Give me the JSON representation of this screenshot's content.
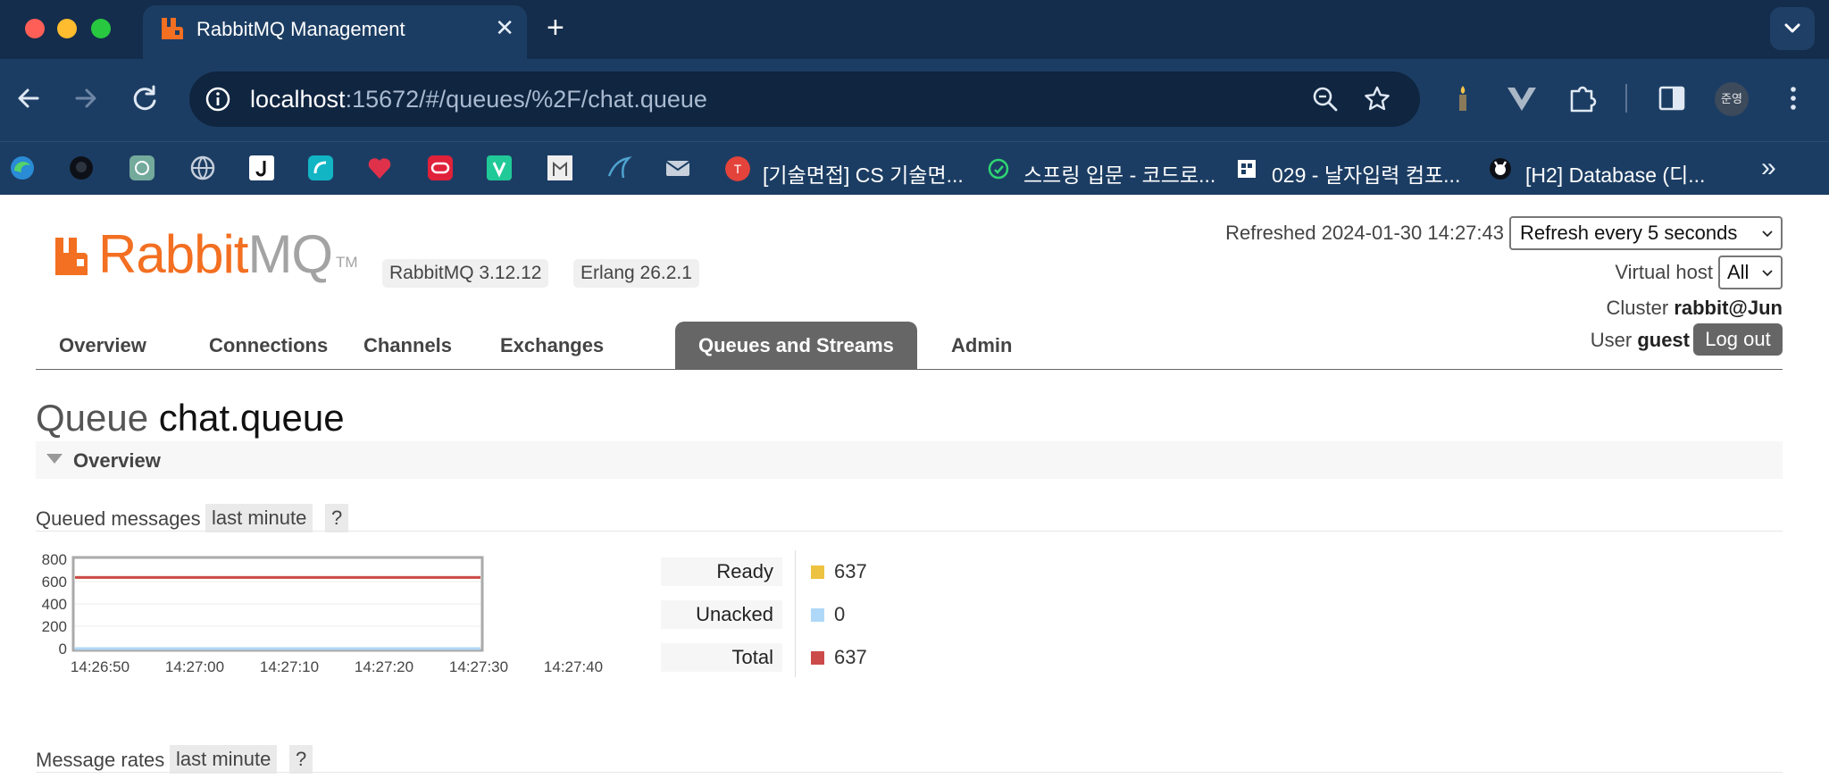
{
  "browser": {
    "tab_title": "RabbitMQ Management",
    "url_host": "localhost",
    "url_rest": ":15672/#/queues/%2F/chat.queue",
    "profile_initials": "준영",
    "bookmarks": [
      {
        "label": "[기술면접] CS 기술면...",
        "icon": "notion-red-icon"
      },
      {
        "label": "스프링 입문 - 코드로...",
        "icon": "inflearn-icon"
      },
      {
        "label": "029 - 날자입력 컴포...",
        "icon": "wikidocs-icon"
      },
      {
        "label": "[H2] Database (디...",
        "icon": "github-icon"
      }
    ]
  },
  "rabbit": {
    "logo_rabbit": "Rabbit",
    "logo_mq": "MQ",
    "logo_tm": "TM",
    "version": "RabbitMQ 3.12.12",
    "erlang": "Erlang 26.2.1",
    "refreshed": "Refreshed 2024-01-30 14:27:43",
    "refresh_option": "Refresh every 5 seconds",
    "vhost_label": "Virtual host",
    "vhost_value": "All",
    "cluster_label": "Cluster",
    "cluster_value": "rabbit@Jun",
    "user_label": "User",
    "user_value": "guest",
    "logout": "Log out",
    "tabs": [
      "Overview",
      "Connections",
      "Channels",
      "Exchanges",
      "Queues and Streams",
      "Admin"
    ],
    "active_tab": "Queues and Streams"
  },
  "queue": {
    "title_prefix": "Queue",
    "name": "chat.queue",
    "section": "Overview",
    "queued_messages_label": "Queued messages",
    "range_pill": "last minute",
    "help": "?",
    "message_rates_label": "Message rates"
  },
  "legend": [
    {
      "label": "Ready",
      "value": "637",
      "color": "#edc240"
    },
    {
      "label": "Unacked",
      "value": "0",
      "color": "#afd8f8"
    },
    {
      "label": "Total",
      "value": "637",
      "color": "#cb4b4b"
    }
  ],
  "chart_data": {
    "type": "line",
    "title": "",
    "xlabel": "",
    "ylabel": "",
    "x": [
      "14:26:50",
      "14:27:00",
      "14:27:10",
      "14:27:20",
      "14:27:30",
      "14:27:40"
    ],
    "y_ticks": [
      0,
      200,
      400,
      600,
      800
    ],
    "ylim": [
      0,
      800
    ],
    "series": [
      {
        "name": "Ready",
        "color": "#edc240",
        "values": [
          637,
          637,
          637,
          637,
          637,
          637
        ]
      },
      {
        "name": "Unacked",
        "color": "#afd8f8",
        "values": [
          0,
          0,
          0,
          0,
          0,
          0
        ]
      },
      {
        "name": "Total",
        "color": "#cb4b4b",
        "values": [
          637,
          637,
          637,
          637,
          637,
          637
        ]
      }
    ]
  }
}
